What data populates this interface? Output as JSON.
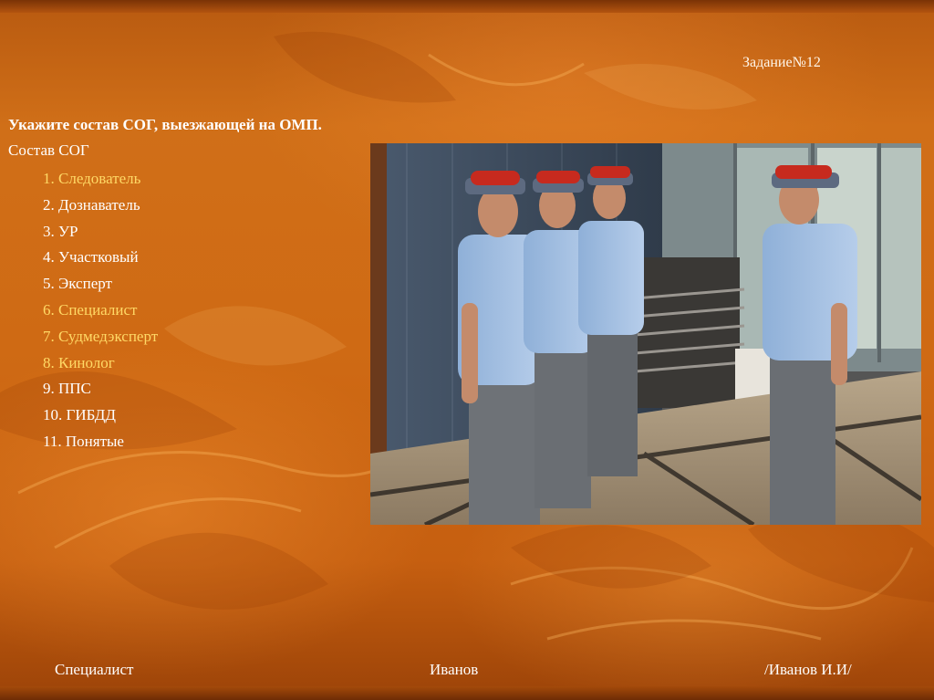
{
  "slide": {
    "task_number": "Задание№12",
    "question": "Укажите состав СОГ, выезжающей на ОМП.",
    "list_title": "Состав СОГ",
    "items": [
      {
        "label": "1. Следователь",
        "highlighted": true
      },
      {
        "label": "2. Дознаватель",
        "highlighted": false
      },
      {
        "label": "3. УР",
        "highlighted": false
      },
      {
        "label": "4. Участковый",
        "highlighted": false
      },
      {
        "label": "5. Эксперт",
        "highlighted": false
      },
      {
        "label": "6. Специалист",
        "highlighted": true
      },
      {
        "label": "7. Судмедэксперт",
        "highlighted": true
      },
      {
        "label": "8. Кинолог",
        "highlighted": true
      },
      {
        "label": "9. ППС",
        "highlighted": false
      },
      {
        "label": "10. ГИБДД",
        "highlighted": false
      },
      {
        "label": "11. Понятые",
        "highlighted": false
      }
    ]
  },
  "footer": {
    "role": "Специалист",
    "surname": "Иванов",
    "signature": "/Иванов И.И/"
  },
  "colors": {
    "highlight": "#ffd966",
    "text": "#ffffff",
    "background": "#c8661a"
  }
}
